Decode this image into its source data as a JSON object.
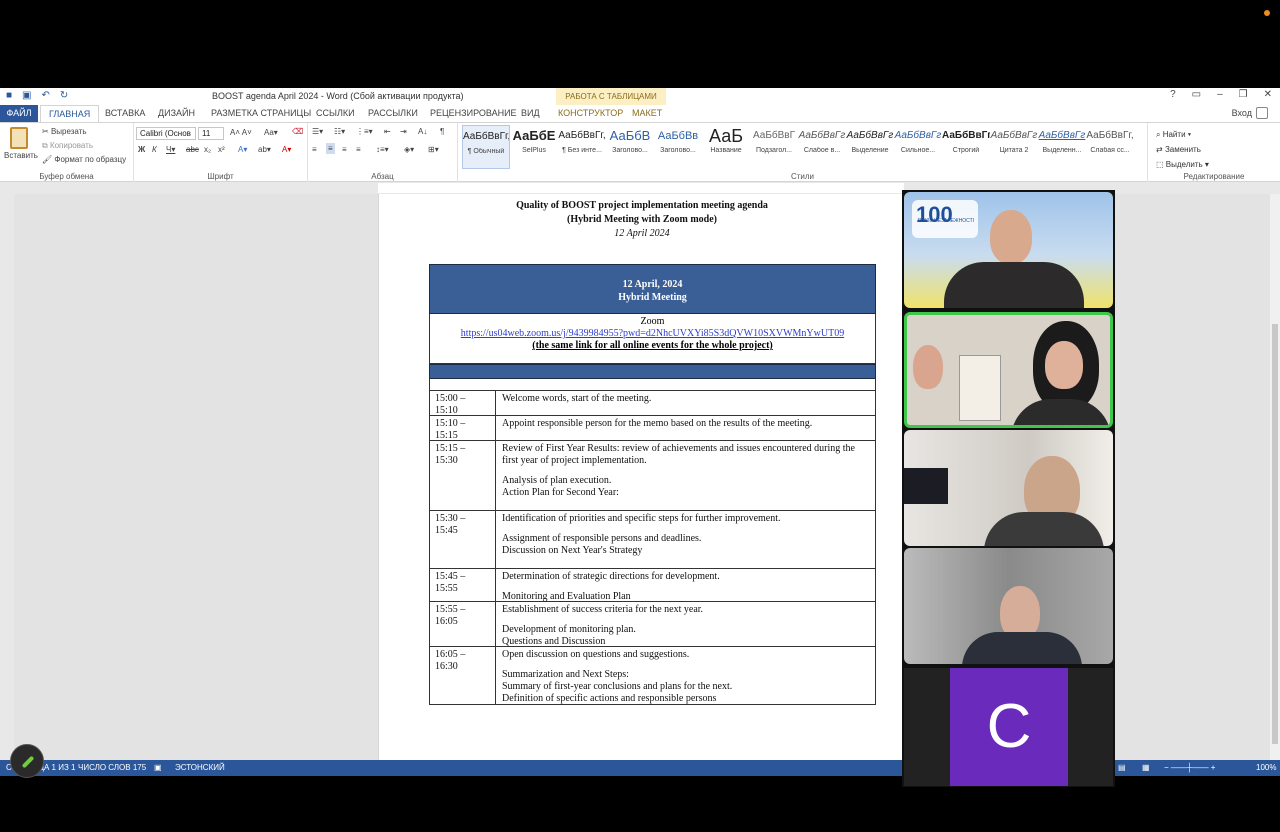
{
  "app": {
    "window_title": "BOOST agenda April 2024 - Word (Сбой активации продукта)",
    "context_band": "РАБОТА С ТАБЛИЦАМИ",
    "login": "Вход"
  },
  "tabs": {
    "file": "ФАЙЛ",
    "home": "ГЛАВНАЯ",
    "insert": "ВСТАВКА",
    "design": "ДИЗАЙН",
    "layout": "РАЗМЕТКА СТРАНИЦЫ",
    "references": "ССЫЛКИ",
    "mailings": "РАССЫЛКИ",
    "review": "РЕЦЕНЗИРОВАНИЕ",
    "view": "ВИД",
    "constructor": "КОНСТРУКТОР",
    "table_layout": "МАКЕТ"
  },
  "ribbon": {
    "paste": "Вставить",
    "cut": "Вырезать",
    "copy": "Копировать",
    "format_painter": "Формат по образцу",
    "clipboard_group": "Буфер обмена",
    "font_name": "Calibri (Основ",
    "font_size": "11",
    "font_group": "Шрифт",
    "paragraph_group": "Абзац",
    "styles_group": "Стили",
    "editing_group": "Редактирование",
    "find": "Найти",
    "replace": "Заменить",
    "select": "Выделить",
    "styles": [
      {
        "preview": "АаБбВвГг,",
        "name": "¶ Обычный"
      },
      {
        "preview": "АаБбЕ",
        "name": "SelPlus"
      },
      {
        "preview": "АаБбВвГг,",
        "name": "¶ Без инте..."
      },
      {
        "preview": "АаБбВ",
        "name": "Заголово..."
      },
      {
        "preview": "АаБбВв",
        "name": "Заголово..."
      },
      {
        "preview": "АаБ",
        "name": "Название"
      },
      {
        "preview": "АаБбВвГ",
        "name": "Подзагол..."
      },
      {
        "preview": "АаБбВвГг",
        "name": "Слабое в..."
      },
      {
        "preview": "АаБбВвГг",
        "name": "Выделение"
      },
      {
        "preview": "АаБбВвГг",
        "name": "Сильное..."
      },
      {
        "preview": "АаБбВвГг,",
        "name": "Строгий"
      },
      {
        "preview": "АаБбВвГг",
        "name": "Цитата 2"
      },
      {
        "preview": "АаБбВвГг",
        "name": "Выделенн..."
      },
      {
        "preview": "АаБбВвГг,",
        "name": "Слабая сс..."
      }
    ]
  },
  "document": {
    "title_line1": "Quality of BOOST project implementation meeting agenda",
    "title_line2": "(Hybrid Meeting with Zoom mode)",
    "title_line3": "12 April 2024",
    "header_date": "12 April, 2024",
    "header_mode": "Hybrid Meeting",
    "zoom_label": "Zoom",
    "zoom_link": "https://us04web.zoom.us/j/9439984955?pwd=d2NhcUVXYi85S3dQVW10SXVWMnYwUT09",
    "zoom_note": "(the same link for all online events for the whole project)",
    "rows": [
      {
        "t1": "15:00 –",
        "t2": "15:10",
        "lines": [
          "Welcome words, start of the meeting."
        ]
      },
      {
        "t1": "15:10 –",
        "t2": "15:15",
        "lines": [
          "Appoint responsible person for the memo based on the results of the meeting."
        ]
      },
      {
        "t1": "15:15 –",
        "t2": "15:30",
        "lines": [
          "Review of First Year Results: review of achievements and issues encountered during the first year of project implementation.",
          "Analysis of plan execution.",
          "Action Plan for Second Year:"
        ]
      },
      {
        "t1": "15:30 –",
        "t2": "15:45",
        "lines": [
          "Identification of priorities and specific steps for further improvement.",
          "Assignment of responsible persons and deadlines.",
          "Discussion on Next Year's Strategy"
        ]
      },
      {
        "t1": "15:45 –",
        "t2": "15:55",
        "lines": [
          "Determination of strategic directions for development.",
          "Monitoring and Evaluation Plan"
        ]
      },
      {
        "t1": "15:55 –",
        "t2": "16:05",
        "lines": [
          "Establishment of success criteria for the next year.",
          "Development of monitoring plan.",
          "Questions and Discussion"
        ]
      },
      {
        "t1": "16:05 –",
        "t2": "16:30",
        "lines": [
          "Open discussion on questions and suggestions.",
          "Summarization and Next Steps:",
          "Summary of first-year conclusions and plans for the next.",
          "Definition of specific actions and responsible persons"
        ]
      }
    ]
  },
  "status": {
    "page": "СТРАНИЦА 1 ИЗ 1",
    "words": "ЧИСЛО СЛОВ 175",
    "language": "ЭСТОНСКИЙ",
    "zoom": "100%"
  },
  "participants": {
    "avatar_letter": "C",
    "logo_text": "100",
    "logo_caption": "РОКІВ НЕЗАЛЕЖНОСТІ"
  }
}
